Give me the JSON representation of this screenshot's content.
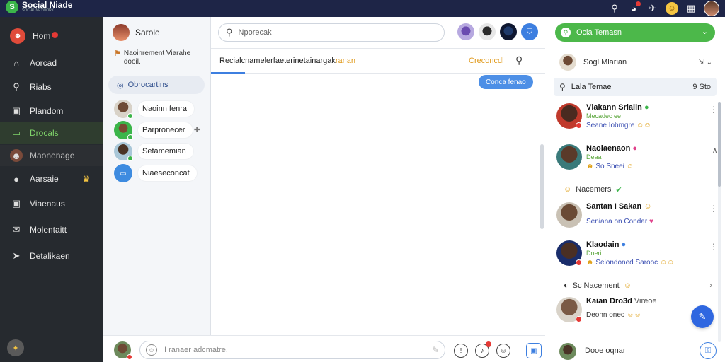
{
  "topbar": {
    "brand_name": "Social Niade",
    "brand_sub": "SOCIAL NETWORK",
    "icons": [
      "search-icon",
      "notifications-icon",
      "send-icon",
      "emoji-icon",
      "grid-icon",
      "profile-avatar"
    ]
  },
  "nav": {
    "items": [
      {
        "label": "Hom",
        "icon": "home-avatar"
      },
      {
        "label": "Aorcad",
        "icon": "house-icon"
      },
      {
        "label": "Riabs",
        "icon": "search-icon"
      },
      {
        "label": "Plandom",
        "icon": "chart-icon"
      },
      {
        "label": "Drocals",
        "icon": "chat-icon"
      },
      {
        "label": "Maonenage",
        "icon": "user-avatar"
      },
      {
        "label": "Aarsaie",
        "icon": "info-icon"
      },
      {
        "label": "Viaenaus",
        "icon": "video-icon"
      },
      {
        "label": "Molentaitt",
        "icon": "mail-icon"
      },
      {
        "label": "Detalikaen",
        "icon": "send-icon"
      }
    ]
  },
  "conversations": {
    "header": "Sarole",
    "note": "Naoinrement Viarahe dooil.",
    "active_label": "Obrocartins",
    "items": [
      {
        "name": "Naoinn fenra"
      },
      {
        "name": "Parpronecer"
      },
      {
        "name": "Setamemian"
      },
      {
        "name": "Niaeseconcat"
      }
    ]
  },
  "chat": {
    "search_placeholder": "Nporecak",
    "title": "Recialcnamelerfaeterinetainargak",
    "title_accent": "ranan",
    "status": "Creconcdl",
    "bubble": "Conca fenao"
  },
  "composer": {
    "placeholder": "I ranaer adcmatre."
  },
  "panel": {
    "header": "Ocla Temasn",
    "user": "Sogl Mlarian",
    "search": "Lala Temae",
    "count": "9 Sto",
    "people": [
      {
        "name": "Vlakann Sriaiin",
        "sub": "Mecadec ee",
        "status": "Seane Iobmgre"
      },
      {
        "name": "Naolaenaon",
        "sub": "Deaa",
        "status": "So Sneei"
      },
      {
        "name": "Santan I Sakan",
        "sub": "",
        "status": "Seniana on Condar"
      },
      {
        "name": "Klaodain",
        "sub": "Dneri",
        "status": "Selondoned Sarooc"
      },
      {
        "name": "Kaian Dro3d",
        "sub": "",
        "status": "Deonn oneo"
      }
    ],
    "group1": "Nacemers",
    "group2": "Sc Nacement",
    "group3_suffix": "Vireoe",
    "footer": "Dooe oqnar"
  }
}
